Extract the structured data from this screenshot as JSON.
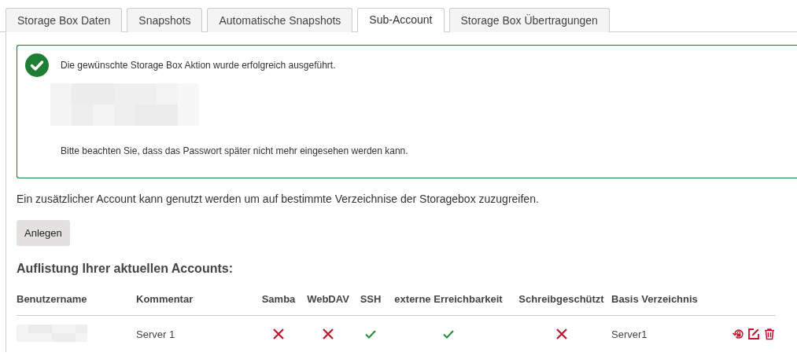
{
  "tabs": [
    {
      "label": "Storage Box Daten",
      "selected": false
    },
    {
      "label": "Snapshots",
      "selected": false
    },
    {
      "label": "Automatische Snapshots",
      "selected": false
    },
    {
      "label": "Sub-Account",
      "selected": true
    },
    {
      "label": "Storage Box Übertragungen",
      "selected": false
    }
  ],
  "alert": {
    "message": "Die gewünschte Storage Box Aktion wurde erfolgreich ausgeführt.",
    "note": "Bitte beachten Sie, dass das Passwort später nicht mehr eingesehen werden kann."
  },
  "description": "Ein zusätzlicher Account kann genutzt werden um auf bestimmte Verzeichnise der Storagebox zuzugreifen.",
  "create_button": "Anlegen",
  "accounts_heading": "Auflistung Ihrer aktuellen Accounts:",
  "table": {
    "columns": [
      "Benutzername",
      "Kommentar",
      "Samba",
      "WebDAV",
      "SSH",
      "externe Erreichbarkeit",
      "Schreibgeschützt",
      "Basis Verzeichnis"
    ],
    "rows": [
      {
        "comment": "Server 1",
        "samba": false,
        "webdav": false,
        "ssh": true,
        "external": true,
        "readonly": false,
        "base_dir": "Server1"
      }
    ]
  }
}
